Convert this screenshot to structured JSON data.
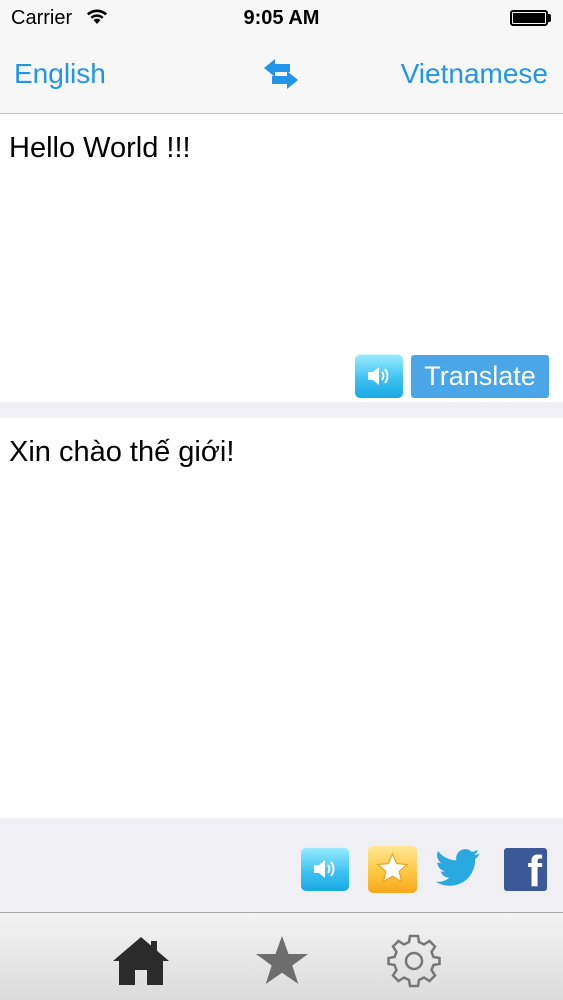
{
  "status_bar": {
    "carrier": "Carrier",
    "time": "9:05 AM"
  },
  "nav": {
    "source_language": "English",
    "target_language": "Vietnamese",
    "swap_icon": "swap-arrows-icon",
    "accent_color": "#2196e8"
  },
  "input": {
    "text": "Hello World !!!"
  },
  "actions": {
    "translate_label": "Translate",
    "speak_icon": "speaker-icon"
  },
  "output": {
    "text": "Xin chào thế giới!"
  },
  "share": {
    "speak_icon": "speaker-icon",
    "favorite_icon": "star-icon",
    "twitter_icon": "twitter-icon",
    "facebook_icon": "facebook-icon",
    "facebook_glyph": "f"
  },
  "tabs": [
    {
      "name": "home",
      "icon": "home-icon"
    },
    {
      "name": "favorites",
      "icon": "star-icon"
    },
    {
      "name": "settings",
      "icon": "gear-icon"
    }
  ]
}
